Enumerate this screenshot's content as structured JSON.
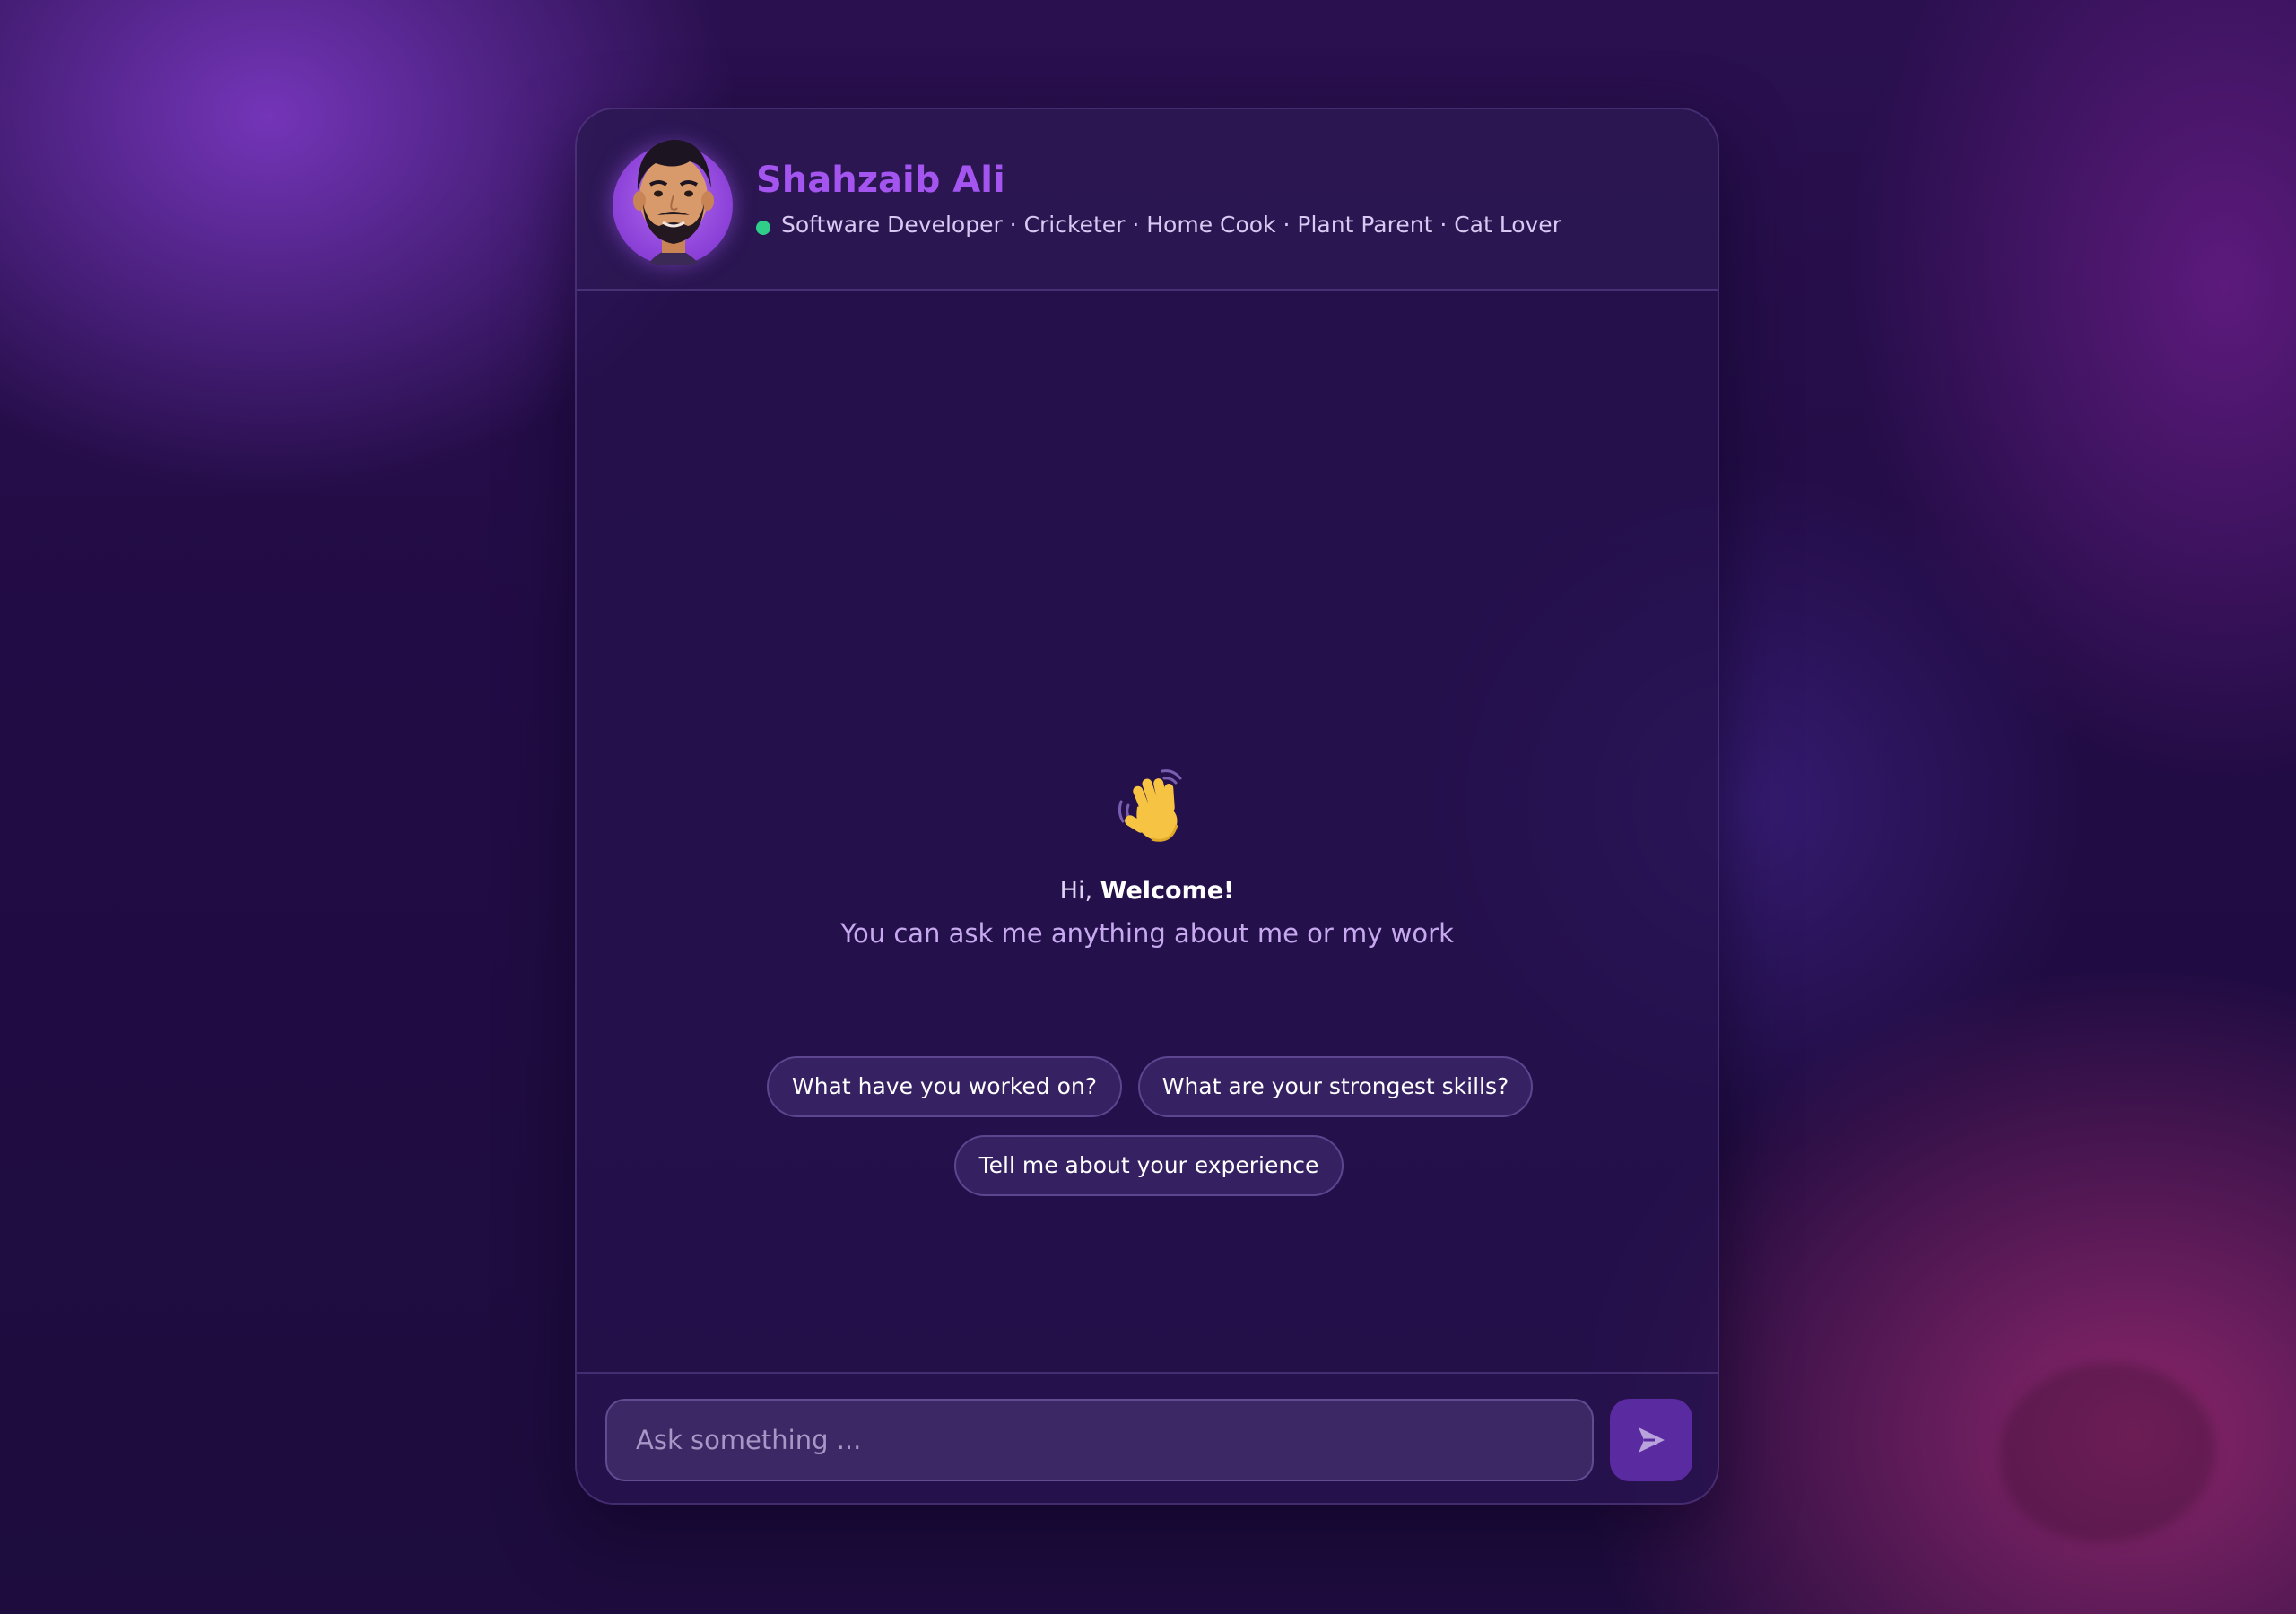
{
  "profile": {
    "name": "Shahzaib Ali",
    "tagline": "Software Developer · Cricketer · Home Cook · Plant Parent · Cat Lover",
    "status_color": "#2fcf8a",
    "avatar_icon": "avatar-portrait-icon"
  },
  "welcome": {
    "emoji": "👋",
    "greeting_prefix": "Hi, ",
    "greeting_emphasis": "Welcome!",
    "subtitle": "You can ask me anything about me or my work"
  },
  "suggestions": [
    {
      "label": "What have you worked on?"
    },
    {
      "label": "What are your strongest skills?"
    },
    {
      "label": "Tell me about your experience"
    }
  ],
  "composer": {
    "placeholder": "Ask something ...",
    "send_icon": "send-icon"
  },
  "colors": {
    "accent": "#a455f0",
    "send_button": "#5a2aa0",
    "background": "#220e48"
  }
}
